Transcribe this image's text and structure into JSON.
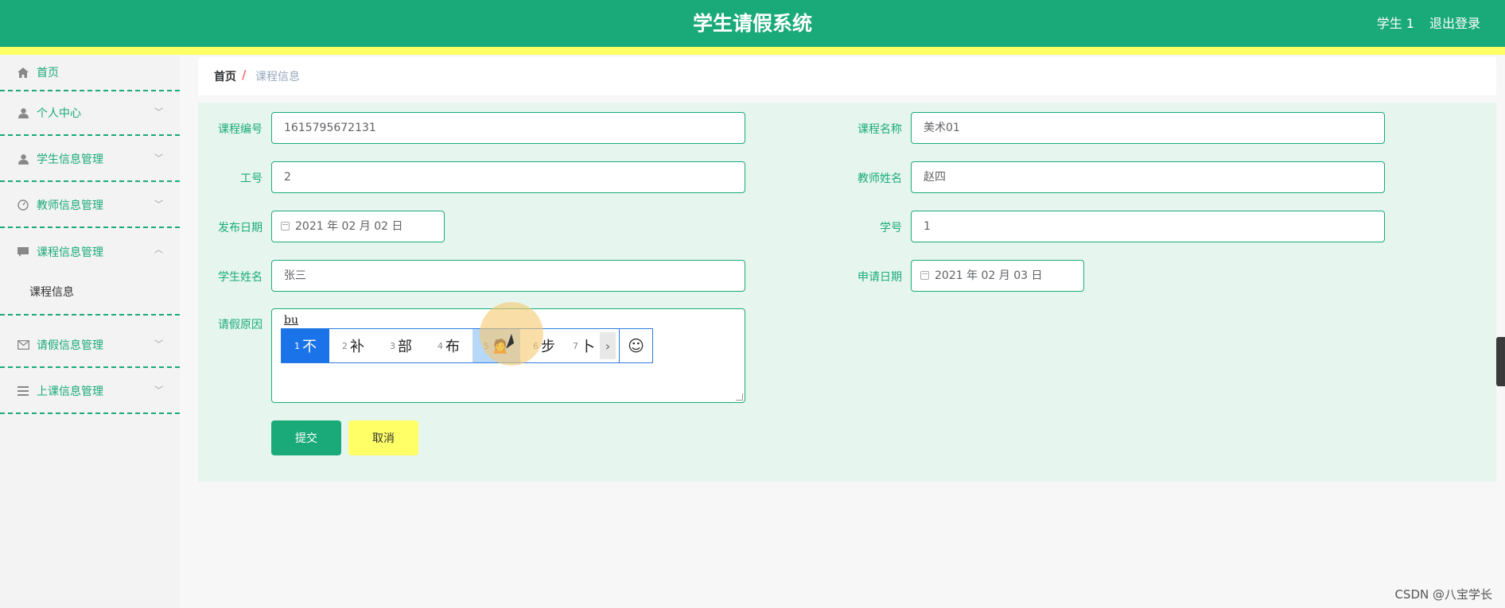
{
  "header": {
    "title": "学生请假系统",
    "user": "学生 1",
    "logout": "退出登录"
  },
  "sidebar": {
    "items": [
      {
        "label": "首页",
        "icon": "home-icon"
      },
      {
        "label": "个人中心",
        "icon": "user-icon"
      },
      {
        "label": "学生信息管理",
        "icon": "user-icon"
      },
      {
        "label": "教师信息管理",
        "icon": "dashboard-icon"
      },
      {
        "label": "课程信息管理",
        "icon": "chat-icon"
      },
      {
        "label": "请假信息管理",
        "icon": "mail-icon"
      },
      {
        "label": "上课信息管理",
        "icon": "list-icon"
      }
    ],
    "subitem": "课程信息"
  },
  "breadcrumb": {
    "home": "首页",
    "separator": "/",
    "current": "课程信息"
  },
  "form": {
    "course_no_label": "课程编号",
    "course_no": "1615795672131",
    "course_name_label": "课程名称",
    "course_name": "美术01",
    "work_no_label": "工号",
    "work_no": "2",
    "teacher_name_label": "教师姓名",
    "teacher_name": "赵四",
    "publish_date_label": "发布日期",
    "publish_date": "2021 年 02 月 02 日",
    "student_no_label": "学号",
    "student_no": "1",
    "student_name_label": "学生姓名",
    "student_name": "张三",
    "apply_date_label": "申请日期",
    "apply_date": "2021 年 02 月 03 日",
    "reason_label": "请假原因",
    "reason_composition": "bu",
    "submit": "提交",
    "cancel": "取消"
  },
  "ime": {
    "candidates": [
      {
        "num": "1",
        "text": "不"
      },
      {
        "num": "2",
        "text": "补"
      },
      {
        "num": "3",
        "text": "部"
      },
      {
        "num": "4",
        "text": "布"
      },
      {
        "num": "5",
        "text": "🙍"
      },
      {
        "num": "6",
        "text": "步"
      },
      {
        "num": "7",
        "text": "卜"
      }
    ],
    "next": "›",
    "emoji": "☺"
  },
  "watermark": "CSDN @八宝学长",
  "colors": {
    "primary": "#1aaa7a",
    "accent": "#ffff66",
    "panel": "#e6f6ef"
  }
}
